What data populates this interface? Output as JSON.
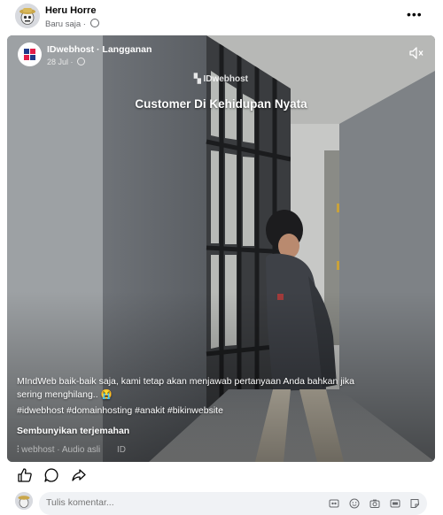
{
  "post": {
    "author": "Heru Horre",
    "time": "Baru saja",
    "separator": "·",
    "more_label": "•••"
  },
  "video": {
    "page_name": "IDwebhost · Langganan",
    "date": "28 Jul ·",
    "watermark": "IDwebhost",
    "title": "Customer Di Kehidupan Nyata",
    "caption": "MIndWeb baik-baik saja, kami tetap akan menjawab pertanyaan Anda bahkan jika sering menghilang.. 😭",
    "hashtags": "#idwebhost #domainhosting #anakit #bikinwebsite",
    "hide_translation": "Sembunyikan terjemahan",
    "audio_label": "webhost · Audio asli",
    "audio_trailing": "ID"
  },
  "comment": {
    "placeholder": "Tulis komentar..."
  },
  "colors": {
    "text": "#050505",
    "secondary": "#65676b",
    "comment_bg": "#f0f2f5"
  },
  "icons": [
    "globe-icon",
    "more-icon",
    "mute-icon",
    "like-icon",
    "comment-icon",
    "share-icon",
    "gif-icon",
    "emoji-icon",
    "camera-icon",
    "sticker-icon"
  ]
}
